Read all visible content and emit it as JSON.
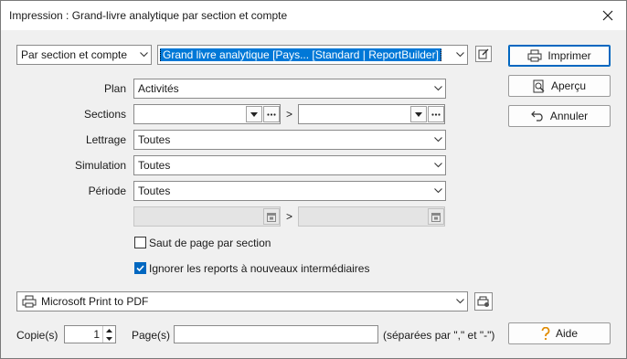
{
  "window": {
    "title": "Impression : Grand-livre analytique par section et compte"
  },
  "top": {
    "sort_combo": "Par section et compte",
    "report_combo": "Grand livre analytique [Pays...        [Standard | ReportBuilder]"
  },
  "form": {
    "plan_label": "Plan",
    "plan_value": "Activités",
    "sections_label": "Sections",
    "sections_from": "",
    "sections_to": "",
    "range_separator": ">",
    "lettrage_label": "Lettrage",
    "lettrage_value": "Toutes",
    "simulation_label": "Simulation",
    "simulation_value": "Toutes",
    "periode_label": "Période",
    "periode_value": "Toutes",
    "date_from": "",
    "date_to": "",
    "saut_label": "Saut de page par section",
    "saut_checked": false,
    "ignorer_label": "Ignorer les reports à nouveaux intermédiaires",
    "ignorer_checked": true
  },
  "buttons": {
    "print": "Imprimer",
    "preview": "Aperçu",
    "cancel": "Annuler",
    "help": "Aide"
  },
  "printer": {
    "name": "Microsoft Print to PDF"
  },
  "footer": {
    "copies_label": "Copie(s)",
    "copies_value": "1",
    "pages_label": "Page(s)",
    "pages_value": "",
    "pages_hint": "(séparées par \",\" et \"-\")"
  },
  "colors": {
    "accent": "#0067c0",
    "selection": "#0078d7",
    "help_icon": "#e08a00"
  }
}
